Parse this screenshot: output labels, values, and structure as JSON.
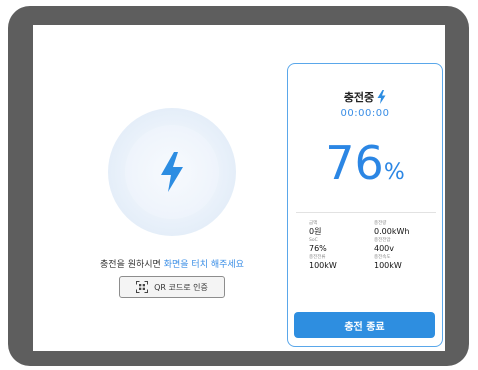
{
  "prompt": {
    "text_plain": "충전을 원하시면",
    "text_highlight": "화면을 터치 해주세요"
  },
  "qr_button": {
    "label": "QR 코드로 인증"
  },
  "status": {
    "title": "충전중",
    "timer": "00:00:00",
    "percent": "76",
    "percent_unit": "%"
  },
  "stats": [
    {
      "label": "금액",
      "value": "0원"
    },
    {
      "label": "충전량",
      "value": "0.00kWh"
    },
    {
      "label": "SoC",
      "value": "76%"
    },
    {
      "label": "충전전압",
      "value": "400v"
    },
    {
      "label": "충전전류",
      "value": "100kW"
    },
    {
      "label": "충전속도",
      "value": "100kW"
    }
  ],
  "end_button": {
    "label": "충전 종료"
  },
  "colors": {
    "accent": "#2e8ee0",
    "frame": "#5e5e5e"
  }
}
